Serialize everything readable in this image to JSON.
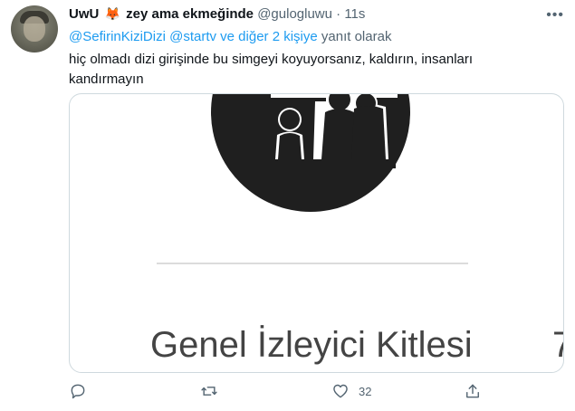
{
  "tweet": {
    "display_name": "UwU",
    "emoji": "🦊",
    "name_suffix": "zey ama ekmeğinde",
    "handle": "@gulogluwu",
    "separator": "·",
    "time": "11s",
    "more_label": "•••",
    "reply_context": {
      "mention1": "@SefirinKiziDizi",
      "mention2": "@startv",
      "others": "ve diğer 2 kişiye",
      "suffix": "yanıt olarak"
    },
    "text": "hiç olmadı dizi girişinde bu simgeyi koyuyorsanız, kaldırın, insanları kandırmayın",
    "media": {
      "caption": "Genel İzleyici Kitlesi",
      "partial_char": "7"
    },
    "actions": {
      "reply_icon": "speech-bubble-icon",
      "retweet_icon": "retweet-icon",
      "like_icon": "heart-icon",
      "like_count": "32",
      "share_icon": "share-icon"
    }
  }
}
